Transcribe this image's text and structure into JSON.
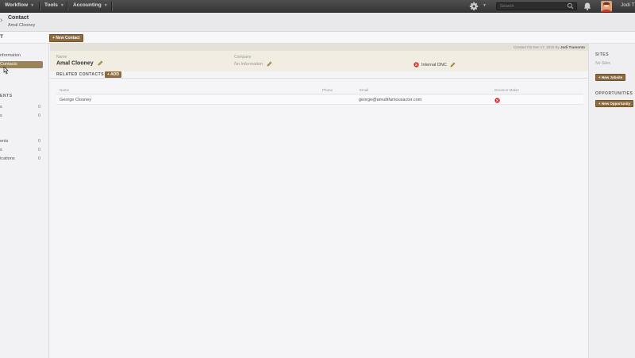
{
  "nav": {
    "menus": [
      "Workflow",
      "Tools",
      "Accounting"
    ],
    "search_placeholder": "Search",
    "user_name": "Jodi T"
  },
  "header": {
    "title": "Contact",
    "subtitle": "Amal Clooney"
  },
  "subbar": {
    "left_label": "T",
    "new_contact_label": "+ New Contact"
  },
  "sidebar": {
    "items": [
      {
        "label": "nformation",
        "active": false
      },
      {
        "label": "Contacts",
        "active": true
      }
    ],
    "section_label": "ENTS",
    "rows_a": [
      {
        "label": "s",
        "count": "0"
      },
      {
        "label": "s",
        "count": "0"
      }
    ],
    "rows_b": [
      {
        "label": "ents",
        "count": "0"
      },
      {
        "label": "s",
        "count": "0"
      },
      {
        "label": "ications",
        "count": "0"
      }
    ]
  },
  "main": {
    "created_text": "Created On Nov 17, 2016 By",
    "created_by": "Jodi Tramonto",
    "name_label": "Name",
    "name_value": "Amal Clooney",
    "company_label": "Company",
    "company_value": "No Information",
    "dnc_label": "Internal DNC",
    "related_title": "RELATED CONTACTS",
    "add_label": "+ ADD",
    "columns": [
      "Name",
      "Phone",
      "Email",
      "Decision Maker"
    ],
    "rows": [
      {
        "name": "George Clooney",
        "phone": "",
        "email": "george@amultifamousactor.com",
        "decision_maker": "no"
      }
    ]
  },
  "rsidebar": {
    "sites_title": "SITES",
    "sites_empty": "No Sites",
    "new_jobsite": "+ New Jobsite",
    "opps_title": "OPPORTUNITIES",
    "new_opp": "+ New Opportunity"
  },
  "colors": {
    "accent_brown": "#8c6b3f",
    "status_red": "#c9302c",
    "topbar": "#404040"
  }
}
